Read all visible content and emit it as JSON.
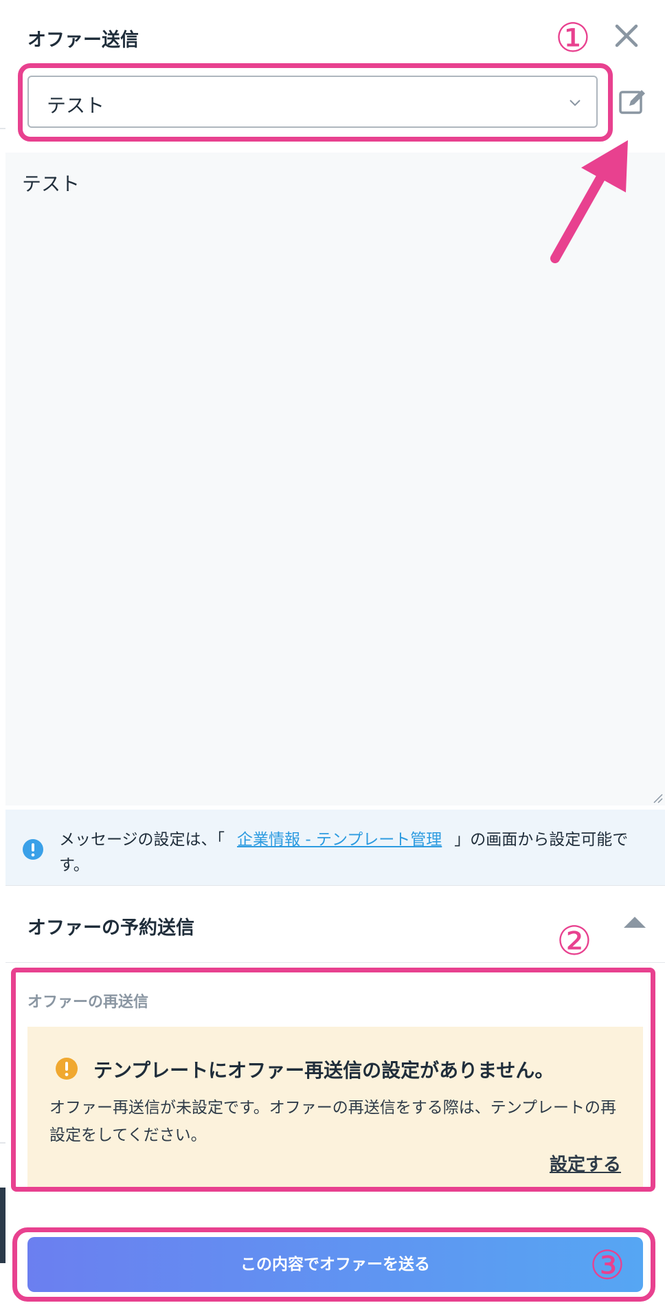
{
  "header": {
    "title": "オファー送信"
  },
  "template_select": {
    "value": "テスト"
  },
  "message": {
    "body": "テスト"
  },
  "info": {
    "prefix": "メッセージの設定は、「",
    "link": "企業情報 - テンプレート管理",
    "suffix": "」の画面から設定可能です。"
  },
  "schedule": {
    "title": "オファーの予約送信"
  },
  "resend": {
    "label": "オファーの再送信",
    "warning_title": "テンプレートにオファー再送信の設定がありません。",
    "warning_body": "オファー再送信が未設定です。オファーの再送信をする際は、テンプレートの再設定をしてください。",
    "settings_link": "設定する"
  },
  "send_button": {
    "label": "この内容でオファーを送る"
  },
  "annotations": {
    "one": "①",
    "two": "②",
    "three": "③"
  },
  "colors": {
    "annotation": "#e8418f",
    "link": "#2d9be0",
    "warning_bg": "#fcf2dc",
    "warning_icon": "#f0a830",
    "info_icon": "#3aa0e8",
    "button_start": "#6b7ff0",
    "button_end": "#56a6f3"
  },
  "icons": {
    "close": "close-icon",
    "edit": "edit-icon",
    "chevron": "chevron-down-icon",
    "info": "info-icon",
    "warning": "warning-icon",
    "collapse": "caret-up-icon"
  }
}
